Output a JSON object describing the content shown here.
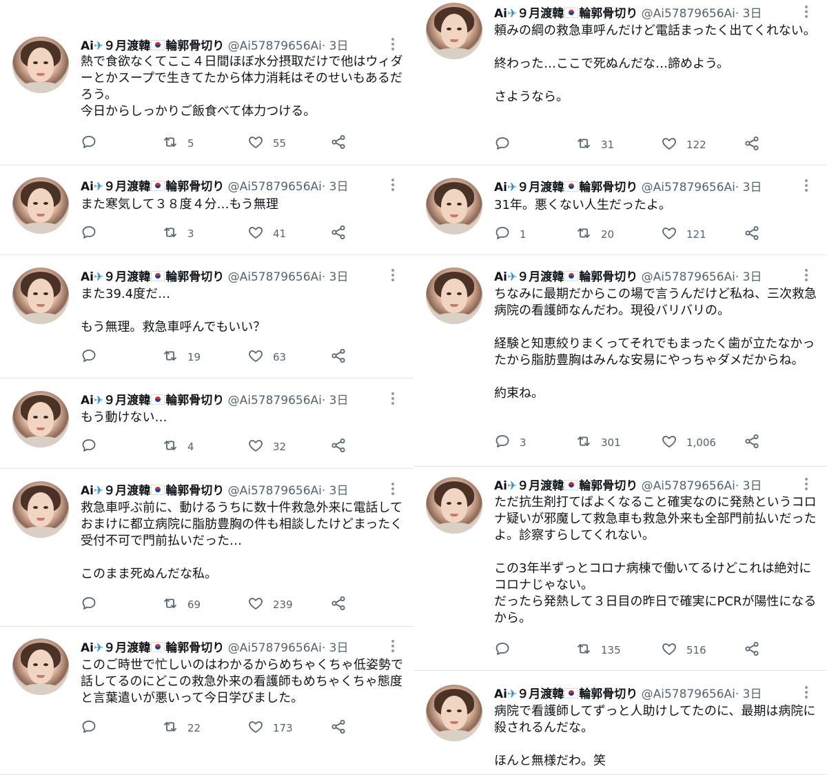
{
  "author": {
    "display_name": "Ai",
    "name_suffix": "９月渡韓",
    "name_tail": "輪郭骨切り",
    "handle": "@Ai57879656Ai",
    "time": "· 3日"
  },
  "colors": {
    "text": "#0f1419",
    "muted": "#536471",
    "divider": "#e6e6e6"
  },
  "icons": [
    "reply-icon",
    "retweet-icon",
    "like-icon",
    "share-icon",
    "airplane-icon",
    "korea-flag-icon",
    "more-icon"
  ],
  "left_tweets": [
    {
      "text": "熱で食欲なくてここ４日間ほぼ水分摂取だけで他はウィダーとかスープで生きてたから体力消耗はそのせいもあるだろう。\n今日からしっかりご飯食べて体力つける。",
      "replies": "",
      "retweets": "5",
      "likes": "55"
    },
    {
      "text": "また寒気して３８度４分…もう無理",
      "replies": "",
      "retweets": "3",
      "likes": "41"
    },
    {
      "text": "また39.4度だ…\n\nもう無理。救急車呼んでもいい？",
      "replies": "",
      "retweets": "19",
      "likes": "63"
    },
    {
      "text": "もう動けない…",
      "replies": "",
      "retweets": "4",
      "likes": "32"
    },
    {
      "text": "救急車呼ぶ前に、動けるうちに数十件救急外来に電話しておまけに都立病院に脂肪豊胸の件も相談したけどまったく受付不可で門前払いだった…\n\nこのまま死ぬんだな私。",
      "replies": "",
      "retweets": "69",
      "likes": "239"
    },
    {
      "text": "このご時世で忙しいのはわかるからめちゃくちゃ低姿勢で話してるのにどこの救急外来の看護師もめちゃくちゃ態度と言葉遣いが悪いって今日学びました。",
      "replies": "",
      "retweets": "22",
      "likes": "173"
    }
  ],
  "right_tweets": [
    {
      "text": "頼みの綱の救急車呼んだけど電話まったく出てくれない。\n\n終わった…ここで死ぬんだな…諦めよう。\n\nさようなら。",
      "replies": "",
      "retweets": "31",
      "likes": "122"
    },
    {
      "text": "31年。悪くない人生だったよ。",
      "replies": "1",
      "retweets": "20",
      "likes": "121"
    },
    {
      "text": "ちなみに最期だからこの場で言うんだけど私ね、三次救急病院の看護師なんだわ。現役バリバリの。\n\n経験と知恵絞りまくってそれでもまったく歯が立たなかったから脂肪豊胸はみんな安易にやっちゃダメだからね。\n\n約束ね。",
      "replies": "3",
      "retweets": "301",
      "likes": "1,006"
    },
    {
      "text": "ただ抗生剤打てばよくなること確実なのに発熱というコロナ疑いが邪魔して救急車も救急外来も全部門前払いだったよ。診察すらしてくれない。\n\nこの3年半ずっとコロナ病棟で働いてるけどこれは絶対にコロナじゃない。\nだったら発熱して３日目の昨日で確実にPCRが陽性になるから。",
      "replies": "",
      "retweets": "135",
      "likes": "516"
    },
    {
      "text": "病院で看護師してずっと人助けしてたのに、最期は病院に殺されるんだな。\n\nほんと無様だわ。笑",
      "replies": "",
      "retweets": "",
      "likes": ""
    }
  ]
}
